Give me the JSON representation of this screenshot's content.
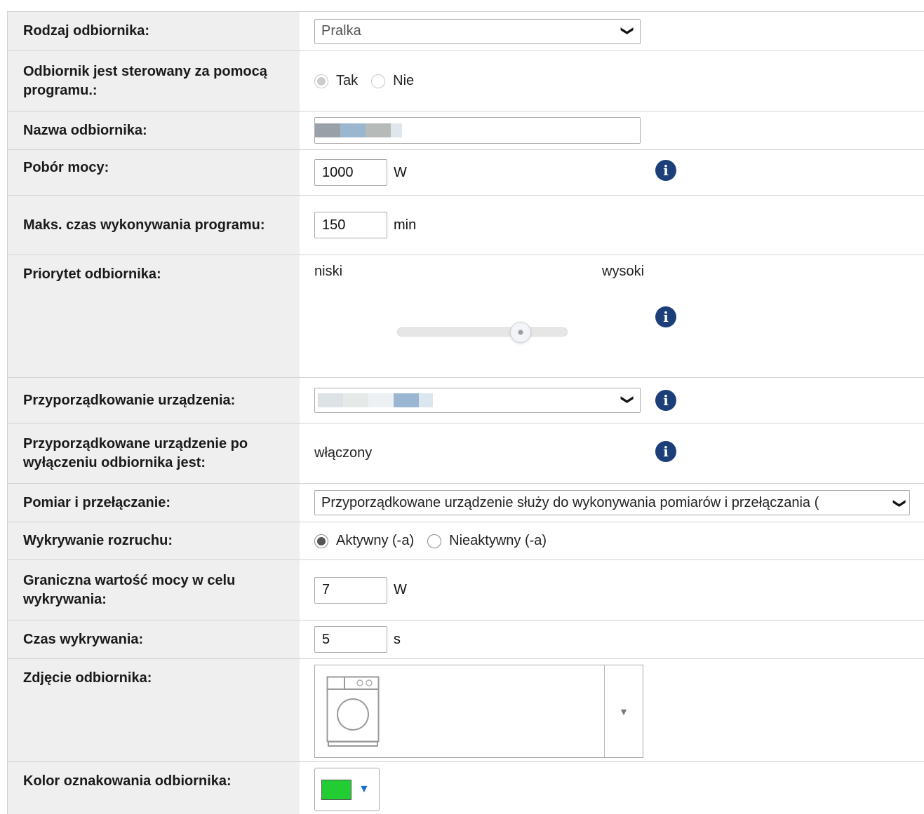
{
  "rows": [
    {
      "label": "Rodzaj odbiornika:",
      "select_value": "Pralka"
    },
    {
      "label": "Odbiornik jest sterowany za pomocą programu.:",
      "options": [
        "Tak",
        "Nie"
      ],
      "selected": "Tak",
      "disabled": true
    },
    {
      "label": "Nazwa odbiornika:",
      "value": ""
    },
    {
      "label": "Pobór mocy:",
      "value": "1000",
      "unit": "W"
    },
    {
      "label": "Maks. czas wykonywania programu:",
      "value": "150",
      "unit": "min"
    },
    {
      "label": "Priorytet odbiornika:",
      "slider_min_label": "niski",
      "slider_max_label": "wysoki",
      "slider_level": 0.72
    },
    {
      "label": "Przyporządkowanie urządzenia:",
      "select_value": ""
    },
    {
      "label": "Przyporządkowane urządzenie po wyłączeniu odbiornika jest:",
      "value": "włączony"
    },
    {
      "label": "Pomiar i przełączanie:",
      "select_value": "Przyporządkowane urządzenie służy do wykonywania pomiarów i przełączania ("
    },
    {
      "label": "Wykrywanie rozruchu:",
      "options": [
        "Aktywny (-a)",
        "Nieaktywny (-a)"
      ],
      "selected": "Aktywny (-a)"
    },
    {
      "label": "Graniczna wartość mocy w celu wykrywania:",
      "value": "7",
      "unit": "W"
    },
    {
      "label": "Czas wykrywania:",
      "value": "5",
      "unit": "s"
    },
    {
      "label": "Zdjęcie odbiornika:",
      "image_icon": "washing-machine-icon"
    },
    {
      "label": "Kolor oznakowania odbiornika:",
      "color": "#22cc33"
    }
  ],
  "icons": {
    "info": "info-icon",
    "chevron": "chevron-down-icon"
  },
  "glyphs": {
    "info": "i",
    "chevron": "❯",
    "caret": "▼"
  },
  "colors": {
    "info": "#1c3f7a",
    "label_bg": "#efefef",
    "accent_caret": "#1b6fc4"
  }
}
